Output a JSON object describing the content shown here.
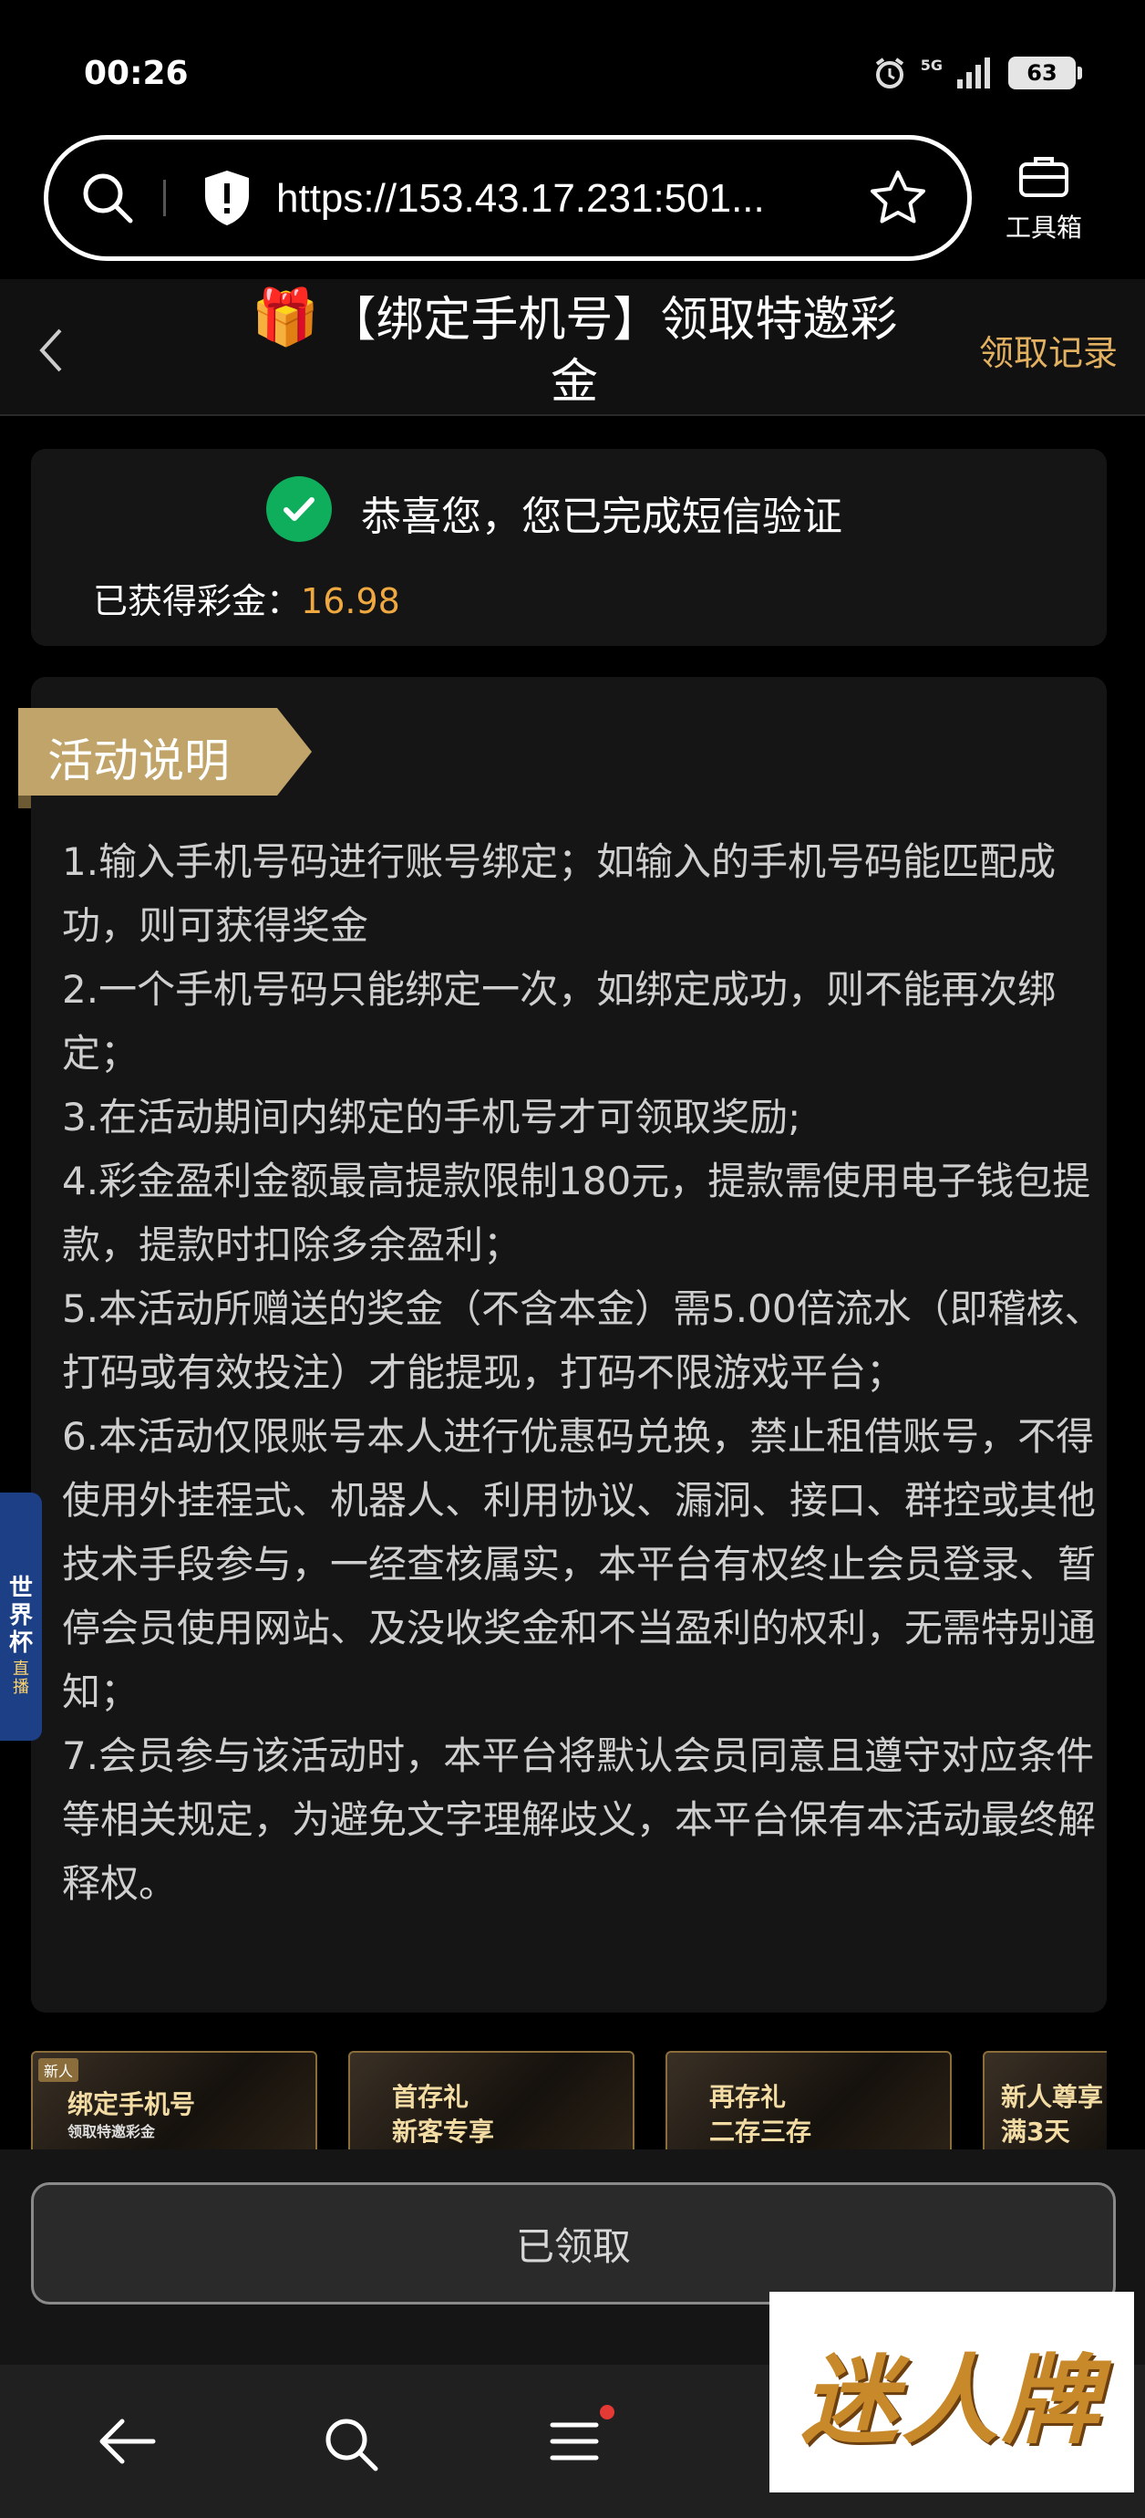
{
  "status_bar": {
    "time": "00:26",
    "network": "5G",
    "battery": "63"
  },
  "browser": {
    "url": "https://153.43.17.231:501...",
    "toolbox_label": "工具箱"
  },
  "header": {
    "title": "【绑定手机号】领取特邀彩金",
    "title_icon": "gift-icon",
    "record_link": "领取记录"
  },
  "verification": {
    "message": "恭喜您，您已完成短信验证",
    "earned_label": "已获得彩金：",
    "earned_value": "16.98"
  },
  "activity": {
    "section_title": "活动说明",
    "rules": [
      "1.输入手机号码进行账号绑定；如输入的手机号码能匹配成功，则可获得奖金",
      "2.一个手机号码只能绑定一次，如绑定成功，则不能再次绑定；",
      "3.在活动期间内绑定的手机号才可领取奖励;",
      "4.彩金盈利金额最高提款限制180元，提款需使用电子钱包提款，提款时扣除多余盈利；",
      "5.本活动所赠送的奖金（不含本金）需5.00倍流水（即稽核、打码或有效投注）才能提现，打码不限游戏平台；",
      "6.本活动仅限账号本人进行优惠码兑换，禁止租借账号，不得使用外挂程式、机器人、利用协议、漏洞、接口、群控或其他技术手段参与，一经查核属实，本平台有权终止会员登录、暂停会员使用网站、及没收奖金和不当盈利的权利，无需特别通知；",
      "7.会员参与该活动时，本平台将默认会员同意且遵守对应条件等相关规定，为避免文字理解歧义，本平台保有本活动最终解释权。"
    ]
  },
  "banners": [
    {
      "tag": "新人",
      "line1": "绑定手机号",
      "line2": "领取特邀彩金"
    },
    {
      "tag": "",
      "line1": "首存礼",
      "line2": "新客专享"
    },
    {
      "tag": "",
      "line1": "再存礼",
      "line2": "二存三存"
    },
    {
      "tag": "",
      "line1": "新人尊享",
      "line2": "满3天"
    }
  ],
  "claim_button": "已领取",
  "side_badge": {
    "text": "世界杯",
    "sub": "直播"
  },
  "logo_text": "迷人牌",
  "colors": {
    "accent_gold": "#e2b061",
    "value_orange": "#f0a840",
    "success_green": "#0fae5c",
    "tag_gold": "#c0a46a"
  }
}
